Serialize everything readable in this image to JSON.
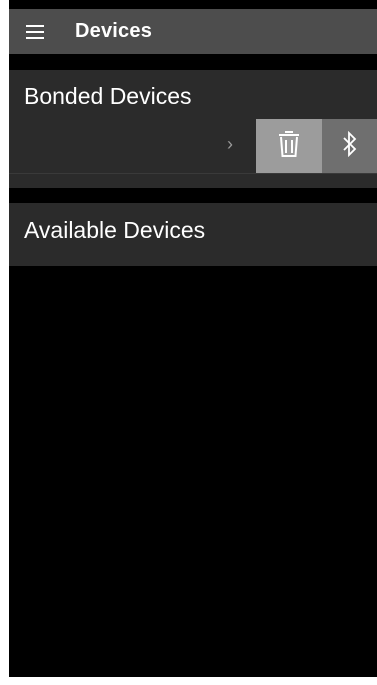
{
  "toolbar": {
    "title": "Devices",
    "menu_icon": "hamburger-menu-icon",
    "background": "#4d4d4d"
  },
  "bonded": {
    "header": "Bonded Devices",
    "row": {
      "chevron": "›",
      "actions": [
        {
          "icon": "trash-icon",
          "background": "#9c9c9c"
        },
        {
          "icon": "bluetooth-icon",
          "background": "#6f6f6f"
        }
      ]
    }
  },
  "available": {
    "header": "Available Devices"
  }
}
